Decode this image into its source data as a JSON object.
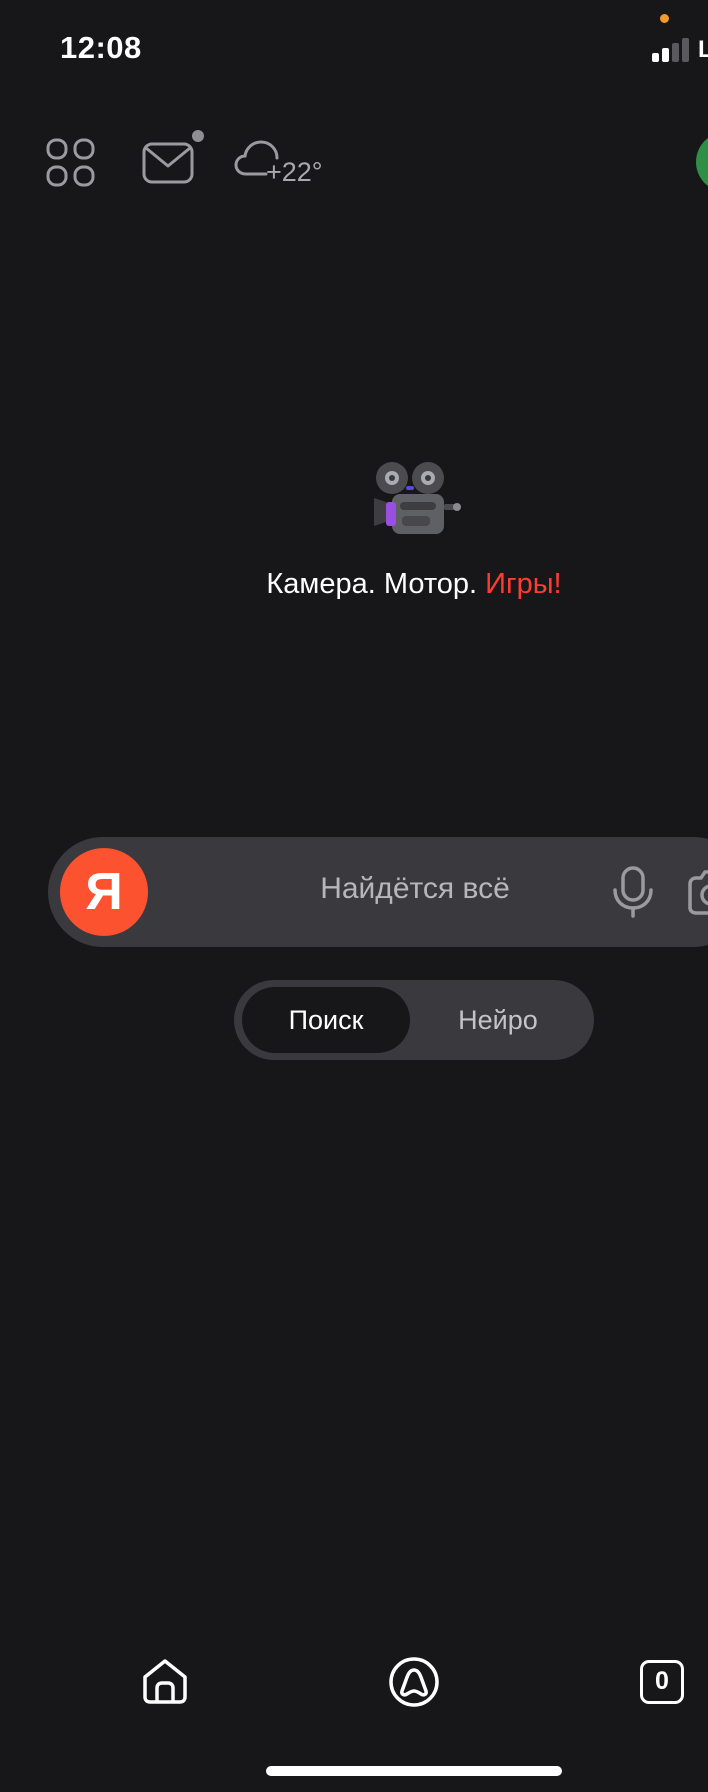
{
  "status_bar": {
    "time": "12:08",
    "carrier_partial": "L",
    "icons": [
      "privacy-indicator-dot",
      "cellular-signal-icon"
    ],
    "privacy_dot_color": "#f29a2e"
  },
  "top_bar": {
    "icons": [
      "services-grid-icon",
      "mail-icon",
      "weather-cloud-icon"
    ],
    "mail_has_badge": true,
    "temperature": "+22°"
  },
  "promo": {
    "emoji": "movie-camera-icon",
    "text_plain": "Камера. Мотор. ",
    "text_accent": "Игры!",
    "accent_color": "#ff3b30"
  },
  "search": {
    "logo_letter": "Я",
    "logo_color": "#fc5230",
    "placeholder": "Найдётся всё",
    "icons": [
      "microphone-icon",
      "camera-icon"
    ]
  },
  "mode_switch": {
    "options": [
      "Поиск",
      "Нейро"
    ],
    "selected": "Поиск"
  },
  "bottom_nav": {
    "icons": [
      "home-icon",
      "alice-icon",
      "tabs-icon"
    ],
    "tabs_count": "0"
  },
  "colors": {
    "background": "#17171a",
    "surface": "#3a3a3e"
  }
}
